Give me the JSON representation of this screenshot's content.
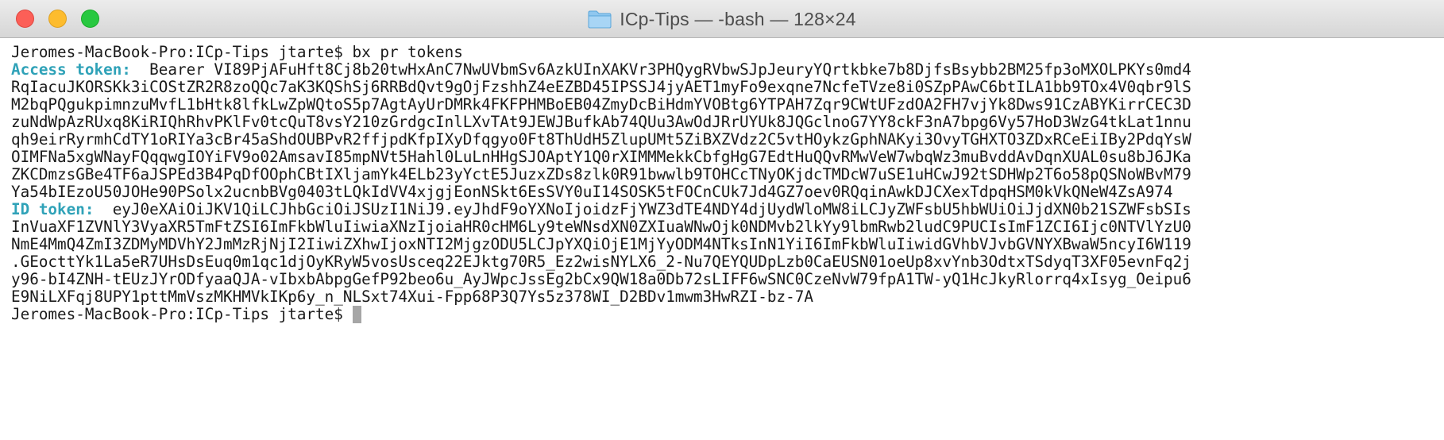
{
  "window": {
    "title": "ICp-Tips — -bash — 128×24",
    "folder_icon": "folder-icon",
    "accent": "#2fa2b8"
  },
  "terminal": {
    "command_line": "Jeromes-MacBook-Pro:ICp-Tips jtarte$ bx pr tokens",
    "access_label": "Access token:",
    "access_lines": [
      "  Bearer VI89PjAFuHft8Cj8b20twHxAnC7NwUVbmSv6AzkUInXAKVr3PHQygRVbwSJpJeuryYQrtkbke7b8DjfsBsybb2BM25fp3oMXOLPKYs0md4",
      "RqIacuJKORSKk3iCOStZR2R8zoQQc7aK3KQShSj6RRBdQvt9gOjFzshhZ4eEZBD45IPSSJ4jyAET1myFo9exqne7NcfeTVze8i0SZpPAwC6btILA1bb9TOx4V0qbr9lS",
      "M2bqPQgukpimnzuMvfL1bHtk8lfkLwZpWQtoS5p7AgtAyUrDMRk4FKFPHMBoEB04ZmyDcBiHdmYVOBtg6YTPAH7Zqr9CWtUFzdOA2FH7vjYk8Dws91CzABYKirrCEC3D",
      "zuNdWpAzRUxq8KiRIQhRhvPKlFv0tcQuT8vsY210zGrdgcInlLXvTAt9JEWJBufkAb74QUu3AwOdJRrUYUk8JQGclnoG7YY8ckF3nA7bpg6Vy57HoD3WzG4tkLat1nnu",
      "qh9eirRyrmhCdTY1oRIYa3cBr45aShdOUBPvR2ffjpdKfpIXyDfqgyo0Ft8ThUdH5ZlupUMt5ZiBXZVdz2C5vtHOykzGphNAKyi3OvyTGHXTO3ZDxRCeEiIBy2PdqYsW",
      "OIMFNa5xgWNayFQqqwgIOYiFV9o02AmsavI85mpNVt5Hahl0LuLnHHgSJOAptY1Q0rXIMMMekkCbfgHgG7EdtHuQQvRMwVeW7wbqWz3muBvddAvDqnXUAL0su8bJ6JKa",
      "ZKCDmzsGBe4TF6aJSPEd3B4PqDfOOphCBtIXljamYk4ELb23yYctE5JuzxZDs8zlk0R91bwwlb9TOHCcTNyOKjdcTMDcW7uSE1uHCwJ92tSDHWp2T6o58pQSNoWBvM79",
      "Ya54bIEzoU50JOHe90PSolx2ucnbBVg0403tLQkIdVV4xjgjEonNSkt6EsSVY0uI14SOSK5tFOCnCUk7Jd4GZ7oev0RQqinAwkDJCXexTdpqHSM0kVkQNeW4ZsA974"
    ],
    "id_label": "ID token:",
    "id_lines": [
      "  eyJ0eXAiOiJKV1QiLCJhbGciOiJSUzI1NiJ9.eyJhdF9oYXNoIjoidzFjYWZ3dTE4NDY4djUydWloMW8iLCJyZWFsbU5hbWUiOiJjdXN0b21SZWFsbSIs",
      "InVuaXF1ZVNlY3VyaXR5TmFtZSI6ImFkbWluIiwiaXNzIjoiaHR0cHM6Ly9teWNsdXN0ZXIuaWNwOjk0NDMvb2lkYy9lbmRwb2ludC9PUCIsImF1ZCI6Ijc0NTVlYzU0",
      "NmE4MmQ4ZmI3ZDMyMDVhY2JmMzRjNjI2IiwiZXhwIjoxNTI2MjgzODU5LCJpYXQiOjE1MjYyODM4NTksInN1YiI6ImFkbWluIiwidGVhbVJvbGVNYXBwaW5ncyI6W119",
      ".GEocttYk1La5eR7UHsDsEuq0m1qc1djOyKRyW5vosUsceq22EJktg70R5_Ez2wisNYLX6_2-Nu7QEYQUDpLzb0CaEUSN01oeUp8xvYnb3OdtxTSdyqT3XF05evnFq2j",
      "y96-bI4ZNH-tEUzJYrODfyaaQJA-vIbxbAbpgGefP92beo6u_AyJWpcJssEg2bCx9QW18a0Db72sLIFF6wSNC0CzeNvW79fpA1TW-yQ1HcJkyRlorrq4xIsyg_Oeipu6",
      "E9NiLXFqj8UPY1pttMmVszMKHMVkIKp6y_n_NLSxt74Xui-Fpp68P3Q7Ys5z378WI_D2BDv1mwm3HwRZI-bz-7A"
    ],
    "prompt": "Jeromes-MacBook-Pro:ICp-Tips jtarte$ "
  }
}
